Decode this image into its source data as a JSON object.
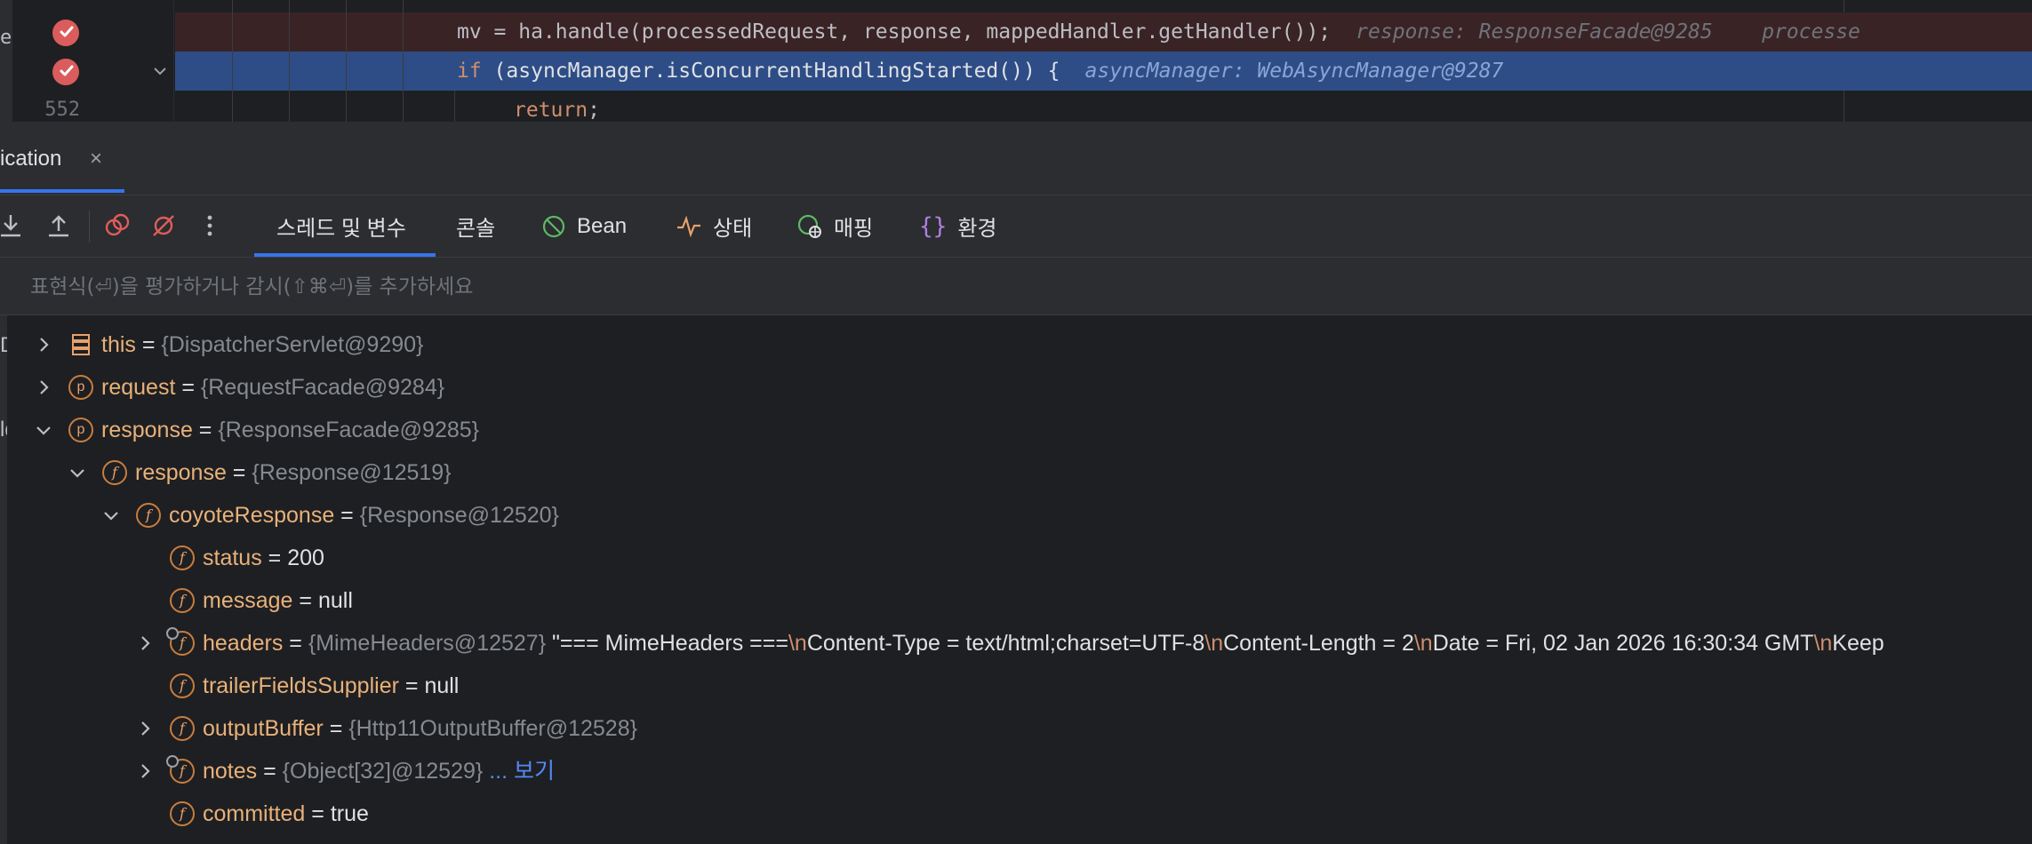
{
  "editor": {
    "lines": [
      {
        "number": "",
        "code": "mv = ha.handle(processedRequest, response, mappedHandler.getHandler());",
        "inlay": "response: ResponseFacade@9285    processe"
      },
      {
        "number": "",
        "code_keyword": "if",
        "code_rest": " (asyncManager.isConcurrentHandlingStarted()) {",
        "inlay": "asyncManager: WebAsyncManager@9287"
      },
      {
        "number": "552",
        "code_keyword": "return",
        "code_rest": ";"
      }
    ],
    "left_fragment_1": "ex",
    "left_fragment_2": "ld",
    "left_fragment_3": "D"
  },
  "debug_session": {
    "tab_label": "ication",
    "close_symbol": "×"
  },
  "toolbar": {
    "icons": [
      "step-into-icon",
      "step-out-icon",
      "view-breakpoints-icon",
      "mute-breakpoints-icon",
      "more-options-icon"
    ],
    "tabs": [
      {
        "label": "스레드 및 변수",
        "icon": "",
        "active": true
      },
      {
        "label": "콘솔",
        "icon": ""
      },
      {
        "label": "Bean",
        "icon": "bean-icon"
      },
      {
        "label": "상태",
        "icon": "health-icon"
      },
      {
        "label": "매핑",
        "icon": "mapping-icon"
      },
      {
        "label": "환경",
        "icon": "environment-icon"
      }
    ]
  },
  "expression": {
    "placeholder": "표현식(⏎)을 평가하거나 감시(⇧⌘⏎)를 추가하세요"
  },
  "variables": [
    {
      "name": "this",
      "eq": " = ",
      "type": "{DispatcherServlet@9290}",
      "icon": "this-icon",
      "chevron": "right",
      "depth": 0
    },
    {
      "name": "request",
      "eq": " = ",
      "type": "{RequestFacade@9284}",
      "icon": "parameter-icon",
      "chevron": "right",
      "depth": 0
    },
    {
      "name": "response",
      "eq": " = ",
      "type": "{ResponseFacade@9285}",
      "icon": "parameter-icon",
      "chevron": "down",
      "depth": 0
    },
    {
      "name": "response",
      "eq": " = ",
      "type": "{Response@12519}",
      "icon": "field-icon",
      "chevron": "down",
      "depth": 1
    },
    {
      "name": "coyoteResponse",
      "eq": " = ",
      "type": "{Response@12520}",
      "icon": "field-icon",
      "chevron": "down",
      "depth": 2
    },
    {
      "name": "status",
      "eq": " = ",
      "value": "200",
      "icon": "field-icon",
      "chevron": "none",
      "depth": 3
    },
    {
      "name": "message",
      "eq": " = ",
      "value": "null",
      "icon": "field-icon",
      "chevron": "none",
      "depth": 3
    },
    {
      "name": "headers",
      "eq": " = ",
      "type": "{MimeHeaders@12527}",
      "value_parts": [
        {
          "t": " \"=== MimeHeaders ===",
          "esc": false
        },
        {
          "t": "\\n",
          "esc": true
        },
        {
          "t": "Content-Type = text/html;charset=UTF-8",
          "esc": false
        },
        {
          "t": "\\n",
          "esc": true
        },
        {
          "t": "Content-Length = 2",
          "esc": false
        },
        {
          "t": "\\n",
          "esc": true
        },
        {
          "t": "Date = Fri, 02 Jan 2026 16:30:34 GMT",
          "esc": false
        },
        {
          "t": "\\n",
          "esc": true
        },
        {
          "t": "Keep",
          "esc": false
        }
      ],
      "icon": "field-locked-icon",
      "chevron": "right",
      "depth": 3
    },
    {
      "name": "trailerFieldsSupplier",
      "eq": " = ",
      "value": "null",
      "icon": "field-icon",
      "chevron": "none",
      "depth": 3
    },
    {
      "name": "outputBuffer",
      "eq": " = ",
      "type": "{Http11OutputBuffer@12528}",
      "icon": "field-icon",
      "chevron": "right",
      "depth": 3
    },
    {
      "name": "notes",
      "eq": " = ",
      "type": "{Object[32]@12529}",
      "link": "... 보기",
      "icon": "field-locked-icon",
      "chevron": "right",
      "depth": 3
    },
    {
      "name": "committed",
      "eq": " = ",
      "value": "true",
      "icon": "field-icon",
      "chevron": "none",
      "depth": 3
    }
  ],
  "colors": {
    "background": "#1e1f22",
    "panel": "#2b2d30",
    "accent": "#3574f0",
    "exec_line": "#2e4d86",
    "breakpoint": "#db5c5c",
    "var_name": "#e8b17a"
  }
}
